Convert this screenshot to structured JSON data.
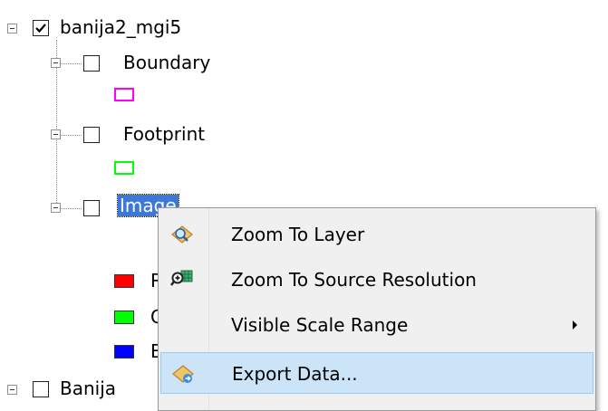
{
  "toc": {
    "layer1": {
      "name": "banija2_mgi5",
      "checked": true
    },
    "sublayers": [
      {
        "name": "Boundary",
        "checked": false,
        "swatch_color": "#ff00ff"
      },
      {
        "name": "Footprint",
        "checked": false,
        "swatch_color": "#00ff00"
      },
      {
        "name": "Image",
        "checked": false,
        "selected": true
      }
    ],
    "image_bands": [
      {
        "label": "R",
        "color": "#ff0000"
      },
      {
        "label": "G",
        "color": "#00ff00"
      },
      {
        "label": "B",
        "color": "#0000ff"
      }
    ],
    "layer2": {
      "name": "Banija",
      "checked": false
    }
  },
  "context_menu": {
    "items": [
      {
        "label": "Zoom To Layer",
        "icon": "zoom-to-layer-icon"
      },
      {
        "label": "Zoom To Source Resolution",
        "icon": "zoom-to-source-resolution-icon"
      },
      {
        "label": "Visible Scale Range",
        "icon": "",
        "has_submenu": true
      },
      {
        "label": "Export Data...",
        "icon": "export-data-icon",
        "highlighted": true
      }
    ]
  }
}
